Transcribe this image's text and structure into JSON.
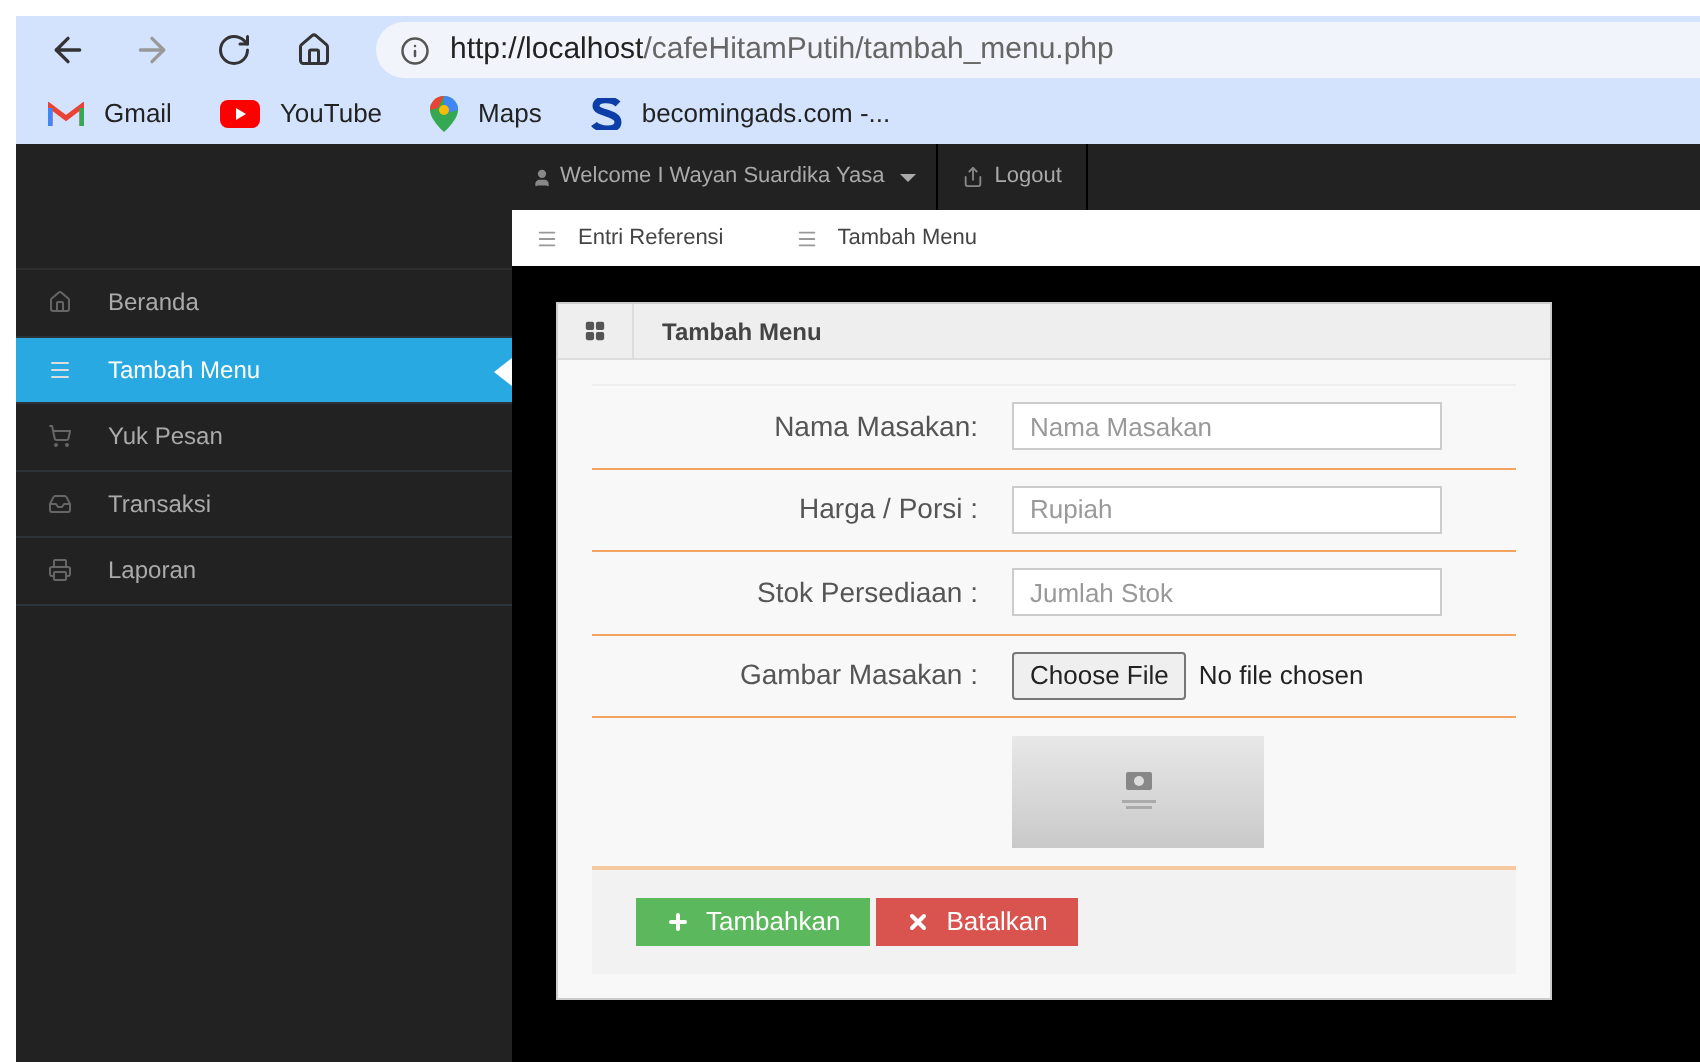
{
  "browser": {
    "url_host": "http://localhost",
    "url_path": "/cafeHitamPutih/tambah_menu.php",
    "bookmarks": [
      {
        "kind": "gmail",
        "label": "Gmail"
      },
      {
        "kind": "youtube",
        "label": "YouTube"
      },
      {
        "kind": "maps",
        "label": "Maps"
      },
      {
        "kind": "s",
        "label": "becomingads.com -..."
      }
    ]
  },
  "navbar": {
    "user": "Welcome I Wayan Suardika Yasa",
    "logout": "Logout"
  },
  "breadcrumbs": [
    "Entri Referensi",
    "Tambah Menu"
  ],
  "sidebar": {
    "items": [
      {
        "kind": "home",
        "label": "Beranda",
        "selected": false
      },
      {
        "kind": "list",
        "label": "Tambah Menu",
        "selected": true
      },
      {
        "kind": "cart",
        "label": "Yuk Pesan",
        "selected": false
      },
      {
        "kind": "inbox",
        "label": "Transaksi",
        "selected": false
      },
      {
        "kind": "print",
        "label": "Laporan",
        "selected": false
      }
    ]
  },
  "panel": {
    "title": "Tambah Menu",
    "rows": [
      {
        "kind": "text",
        "label": "Nama Masakan:",
        "placeholder": "Nama Masakan"
      },
      {
        "kind": "text",
        "label": "Harga / Porsi :",
        "placeholder": "Rupiah"
      },
      {
        "kind": "text",
        "label": "Stok Persediaan :",
        "placeholder": "Jumlah Stok"
      },
      {
        "kind": "file",
        "label": "Gambar Masakan :",
        "button": "Choose File",
        "status": "No file chosen"
      },
      {
        "kind": "picture"
      }
    ],
    "buttons": [
      {
        "kind": "add",
        "label": "Tambahkan"
      },
      {
        "kind": "cancel",
        "label": "Batalkan"
      }
    ]
  }
}
